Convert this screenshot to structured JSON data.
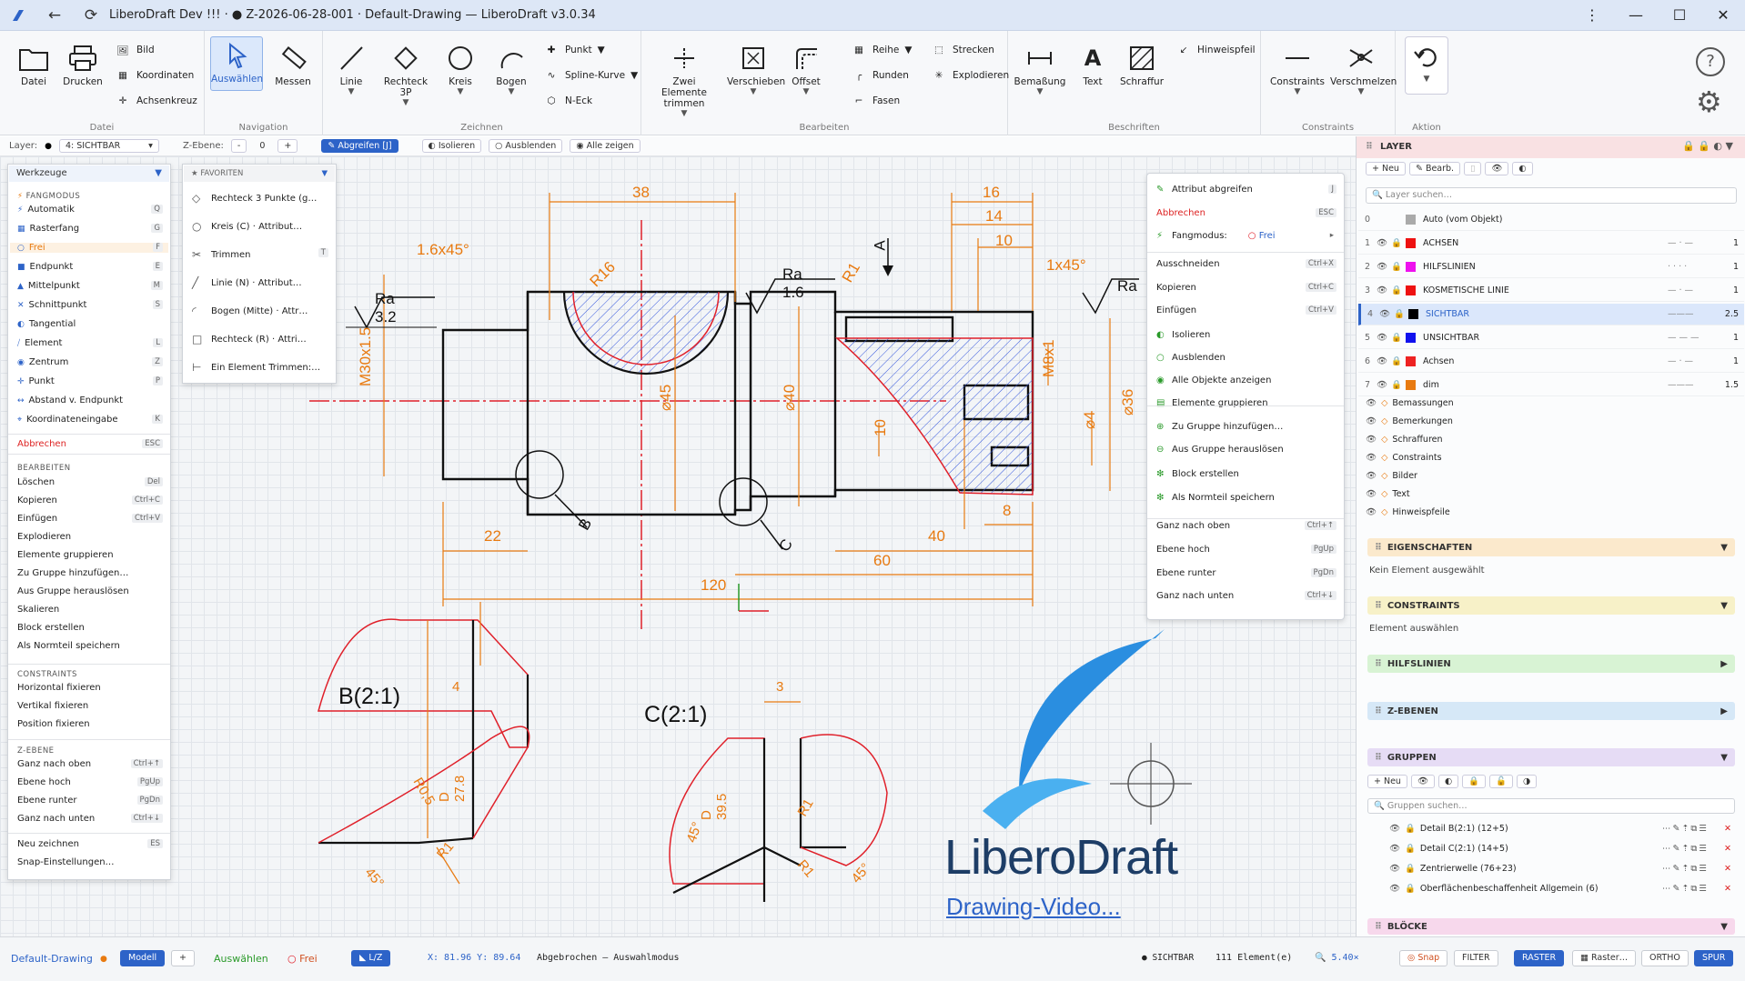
{
  "window": {
    "title": "LiberoDraft Dev !!! · ● Z-2026-06-28-001 · Default-Drawing — LiberoDraft v3.0.34"
  },
  "ribbon": {
    "groups": {
      "datei": "Datei",
      "navigation": "Navigation",
      "zeichnen": "Zeichnen",
      "bearbeiten": "Bearbeiten",
      "beschriften": "Beschriften",
      "constraints": "Constraints",
      "aktion": "Aktion"
    },
    "buttons": {
      "datei": "Datei",
      "drucken": "Drucken",
      "bild": "Bild",
      "koordinaten": "Koordinaten",
      "achsenkreuz": "Achsenkreuz",
      "auswaehlen": "Auswählen",
      "messen": "Messen",
      "linie": "Linie",
      "rechteck3p": "Rechteck 3P",
      "kreis": "Kreis",
      "bogen": "Bogen",
      "punkt": "Punkt",
      "spline": "Spline-Kurve",
      "neck": "N-Eck",
      "zwei_trimmen": "Zwei Elemente trimmen",
      "verschieben": "Verschieben",
      "offset": "Offset",
      "reihe": "Reihe",
      "runden": "Runden",
      "fasen": "Fasen",
      "strecken": "Strecken",
      "explodieren": "Explodieren",
      "bemassung": "Bemaßung",
      "text": "Text",
      "schraffur": "Schraffur",
      "hinweispfeil": "Hinweispfeil",
      "constraints": "Constraints",
      "verschmelzen": "Verschmelzen"
    }
  },
  "optionsbar": {
    "layer_label": "Layer:",
    "layer_value": "4: SICHTBAR",
    "zebene_label": "Z-Ebene:",
    "zebene_value": "0",
    "minus": "-",
    "plus": "+",
    "abgreifen": "Abgreifen [J]",
    "isolieren": "Isolieren",
    "ausblenden": "Ausblenden",
    "alle_zeigen": "Alle zeigen"
  },
  "tools_panel": {
    "header": "Werkzeuge",
    "fang_title": "FANGMODUS",
    "fang": [
      {
        "label": "Automatik",
        "key": "Q"
      },
      {
        "label": "Rasterfang",
        "key": "G"
      },
      {
        "label": "Frei",
        "key": "F"
      },
      {
        "label": "Endpunkt",
        "key": "E"
      },
      {
        "label": "Mittelpunkt",
        "key": "M"
      },
      {
        "label": "Schnittpunkt",
        "key": "S"
      },
      {
        "label": "Tangential",
        "key": ""
      },
      {
        "label": "Element",
        "key": "L"
      },
      {
        "label": "Zentrum",
        "key": "Z"
      },
      {
        "label": "Punkt",
        "key": "P"
      },
      {
        "label": "Abstand v. Endpunkt",
        "key": ""
      },
      {
        "label": "Koordinateneingabe",
        "key": "K"
      }
    ],
    "abbrechen": "Abbrechen",
    "abbrechen_key": "ESC",
    "bearb_title": "BEARBEITEN",
    "bearb": [
      {
        "label": "Löschen",
        "key": "Del"
      },
      {
        "label": "Kopieren",
        "key": "Ctrl+C"
      },
      {
        "label": "Einfügen",
        "key": "Ctrl+V"
      },
      {
        "label": "Explodieren",
        "key": ""
      },
      {
        "label": "Elemente gruppieren",
        "key": ""
      },
      {
        "label": "Zu Gruppe hinzufügen…",
        "key": ""
      },
      {
        "label": "Aus Gruppe herauslösen",
        "key": ""
      },
      {
        "label": "Skalieren",
        "key": ""
      },
      {
        "label": "Block erstellen",
        "key": ""
      },
      {
        "label": "Als Normteil speichern",
        "key": ""
      }
    ],
    "cons_title": "CONSTRAINTS",
    "cons": [
      "Horizontal fixieren",
      "Vertikal fixieren",
      "Position fixieren"
    ],
    "zeb_title": "Z-EBENE",
    "zeb": [
      {
        "label": "Ganz nach oben",
        "key": "Ctrl+↑"
      },
      {
        "label": "Ebene hoch",
        "key": "PgUp"
      },
      {
        "label": "Ebene runter",
        "key": "PgDn"
      },
      {
        "label": "Ganz nach unten",
        "key": "Ctrl+↓"
      }
    ],
    "neu": "Neu zeichnen",
    "neu_key": "ES",
    "snap": "Snap-Einstellungen…"
  },
  "fav_panel": {
    "header": "FAVORITEN",
    "items": [
      {
        "label": "Rechteck 3 Punkte (g…",
        "key": ""
      },
      {
        "label": "Kreis (C) · Attribut…",
        "key": ""
      },
      {
        "label": "Trimmen",
        "key": "T"
      },
      {
        "label": "Linie (N) · Attribut…",
        "key": ""
      },
      {
        "label": "Bogen (Mitte) · Attr…",
        "key": ""
      },
      {
        "label": "Rechteck (R) · Attri…",
        "key": ""
      },
      {
        "label": "Ein Element Trimmen:…",
        "key": ""
      }
    ]
  },
  "context_menu": {
    "items": [
      {
        "label": "Attribut abgreifen",
        "key": "J"
      },
      {
        "label": "Abbrechen",
        "key": "ESC",
        "red": true
      },
      {
        "label": "Fangmodus:",
        "value": "Frei",
        "sub": "▸"
      },
      {
        "label": "Ausschneiden",
        "key": "Ctrl+X"
      },
      {
        "label": "Kopieren",
        "key": "Ctrl+C"
      },
      {
        "label": "Einfügen",
        "key": "Ctrl+V"
      },
      {
        "label": "Isolieren",
        "key": ""
      },
      {
        "label": "Ausblenden",
        "key": ""
      },
      {
        "label": "Alle Objekte anzeigen",
        "key": ""
      },
      {
        "label": "Elemente gruppieren",
        "key": ""
      },
      {
        "label": "Zu Gruppe hinzufügen…",
        "key": ""
      },
      {
        "label": "Aus Gruppe herauslösen",
        "key": ""
      },
      {
        "label": "Block erstellen",
        "key": ""
      },
      {
        "label": "Als Normteil speichern",
        "key": ""
      },
      {
        "label": "Ganz nach oben",
        "key": "Ctrl+↑"
      },
      {
        "label": "Ebene hoch",
        "key": "PgUp"
      },
      {
        "label": "Ebene runter",
        "key": "PgDn"
      },
      {
        "label": "Ganz nach unten",
        "key": "Ctrl+↓"
      }
    ]
  },
  "drawing": {
    "dims": [
      "38",
      "16",
      "14",
      "10",
      "1.6x45°",
      "1x45°",
      "Ra 3.2",
      "Ra 1.6",
      "Ra",
      "R16",
      "R1",
      "A",
      "M30x1.5",
      "⌀45",
      "⌀40",
      "⌀36",
      "M8x1",
      "10",
      "⌀4",
      "22",
      "40",
      "8",
      "60",
      "120",
      "B",
      "C"
    ],
    "detail_b": {
      "title": "B(2:1)",
      "dims": [
        "4",
        "R0,5",
        "D 27.8",
        "R1",
        "45°"
      ]
    },
    "detail_c": {
      "title": "C(2:1)",
      "dims": [
        "3",
        "D 39.5",
        "45°",
        "R1",
        "R1",
        "45°"
      ]
    }
  },
  "logo": {
    "name": "LiberoDraft",
    "link": "Drawing-Video..."
  },
  "layer_panel": {
    "title": "LAYER",
    "neu": "+ Neu",
    "bearb": "Bearb.",
    "search": "Layer suchen…",
    "rows": [
      {
        "num": "0",
        "name": "Auto (vom Objekt)",
        "color": "#aaaaaa",
        "line": "",
        "w": ""
      },
      {
        "num": "1",
        "name": "ACHSEN",
        "color": "#ee1111",
        "line": "— · —",
        "w": "1"
      },
      {
        "num": "2",
        "name": "HILFSLINIEN",
        "color": "#ee11ee",
        "line": "· · · ·",
        "w": "1"
      },
      {
        "num": "3",
        "name": "KOSMETISCHE LINIE",
        "color": "#ee1111",
        "line": "— · —",
        "w": "1"
      },
      {
        "num": "4",
        "name": "SICHTBAR",
        "color": "#000000",
        "line": "———",
        "w": "2.5"
      },
      {
        "num": "5",
        "name": "UNSICHTBAR",
        "color": "#1111ee",
        "line": "— — —",
        "w": "1"
      },
      {
        "num": "6",
        "name": "Achsen",
        "color": "#ee2222",
        "line": "— · —",
        "w": "1"
      },
      {
        "num": "7",
        "name": "dim",
        "color": "#e87a10",
        "line": "———",
        "w": "1.5"
      }
    ],
    "categories": [
      "Bemassungen",
      "Bemerkungen",
      "Schraffuren",
      "Constraints",
      "Bilder",
      "Text",
      "Hinweispfeile"
    ]
  },
  "props": {
    "title": "EIGENSCHAFTEN",
    "text": "Kein Element ausgewählt"
  },
  "constraints_sec": {
    "title": "CONSTRAINTS",
    "text": "Element auswählen"
  },
  "hilfslinien": {
    "title": "HILFSLINIEN"
  },
  "zebenen": {
    "title": "Z-EBENEN"
  },
  "gruppen": {
    "title": "GRUPPEN",
    "neu": "+ Neu",
    "search": "Gruppen suchen…",
    "items": [
      "Detail B(2:1) (12+5)",
      "Detail C(2:1) (14+5)",
      "Zentrierwelle (76+23)",
      "Oberflächenbeschaffenheit Allgemein (6)"
    ]
  },
  "bloecke": {
    "title": "BLÖCKE"
  },
  "status": {
    "drawing": "Default-Drawing",
    "modell": "Modell",
    "plus": "+",
    "mode": "Auswählen",
    "fang": "Frei",
    "coord": "X: 81.96 Y: 89.64",
    "msg": "Abgebrochen — Auswahlmodus",
    "layer": "SICHTBAR",
    "count": "111 Element(e)",
    "zoom": "5.40×",
    "snap": "Snap",
    "filter": "FILTER",
    "raster": "RASTER",
    "raster2": "Raster…",
    "ortho": "ORTHO",
    "spur": "SPUR"
  },
  "colors": {
    "accent": "#2d63c8",
    "dim": "#e87a10",
    "axis": "#e0202a",
    "hatch": "#3355dd"
  }
}
